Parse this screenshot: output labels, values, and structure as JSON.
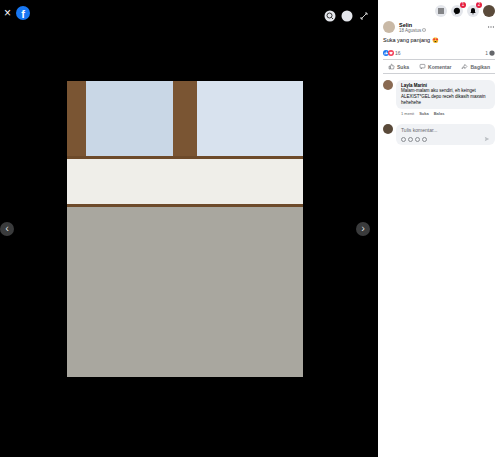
{
  "topbar": {
    "close": "×",
    "logo": "f"
  },
  "nav": {
    "prev": "‹",
    "next": "›"
  },
  "header": {
    "messenger_badge": "1",
    "notifications_badge": "2"
  },
  "post": {
    "author": "Selin",
    "date": "18 Agustus",
    "caption": "Suka yang panjang 😍",
    "reactions_count": "16",
    "comments_count": "1"
  },
  "actions": [
    {
      "label": "Suka",
      "kind": "like"
    },
    {
      "label": "Komentar",
      "kind": "comment"
    },
    {
      "label": "Bagikan",
      "kind": "share"
    }
  ],
  "comments": [
    {
      "author": "Layla Marini",
      "text": "Malam-malam aku sendiri, eh keinget ALEXIST*GEL depo receh dikasih maxwin hehehehe",
      "time": "1 menit",
      "actions": [
        "Suka",
        "Balas"
      ]
    }
  ],
  "composer": {
    "placeholder": "Tulis komentar..."
  }
}
